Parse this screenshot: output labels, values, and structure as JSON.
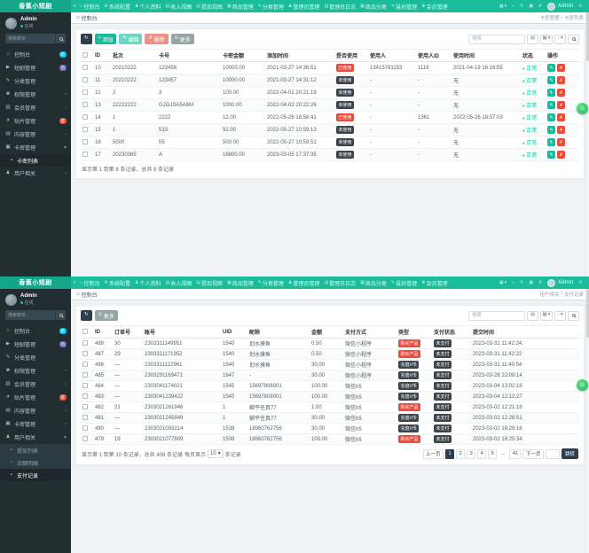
{
  "brand": "香蕉小短剧",
  "nav": {
    "items": [
      {
        "label": "控制台",
        "icon": "home-icon"
      },
      {
        "label": "系统配置",
        "icon": "gear-icon"
      },
      {
        "label": "个人资料",
        "icon": "person-icon"
      },
      {
        "label": "收入视图",
        "icon": "chart-icon"
      },
      {
        "label": "提现视图",
        "icon": "chart-icon"
      },
      {
        "label": "商品管理",
        "icon": "bag-icon"
      },
      {
        "label": "分类管理",
        "icon": "pencil-icon"
      },
      {
        "label": "管理员管理",
        "icon": "users-icon"
      },
      {
        "label": "管理员日志",
        "icon": "log-icon"
      },
      {
        "label": "商品分类",
        "icon": "bag-icon"
      },
      {
        "label": "装扮管理",
        "icon": "paint-icon"
      },
      {
        "label": "会员管理",
        "icon": "crown-icon"
      }
    ],
    "admin_name": "Admin"
  },
  "sidebar": {
    "user_name": "Admin",
    "user_status": "在线",
    "search_placeholder": "搜索菜单",
    "menu": [
      {
        "label": "控制台",
        "icon": "dashboard-icon",
        "badge": "新",
        "badge_color": "#00c0ef"
      },
      {
        "label": "短剧管理",
        "icon": "video-icon",
        "badge": "热",
        "badge_color": "#7266ba"
      },
      {
        "label": "分类管理",
        "icon": "category-icon"
      },
      {
        "label": "权限管理",
        "icon": "auth-icon",
        "chevron": true
      },
      {
        "label": "会员管理",
        "icon": "member-icon",
        "chevron": true
      },
      {
        "label": "贴片管理",
        "icon": "ad-icon",
        "badge": "荐",
        "badge_color": "#e74c3c"
      },
      {
        "label": "内容管理",
        "icon": "content-icon",
        "chevron": true
      },
      {
        "label": "卡密管理",
        "icon": "card-icon",
        "chevron": true,
        "key": "card",
        "children": [
          {
            "label": "卡密列表",
            "key": "cardlist"
          }
        ]
      },
      {
        "label": "用户相关",
        "icon": "user-icon",
        "chevron": true,
        "key": "user",
        "children": [
          {
            "label": "提现列表",
            "key": "withdraw"
          },
          {
            "label": "余额明细",
            "key": "balance"
          },
          {
            "label": "支付记录",
            "key": "payrecord"
          }
        ]
      }
    ]
  },
  "colors": {
    "accent": "#1abc9c",
    "danger": "#e74c3c",
    "dark_badge": "#3b434b",
    "sidebar": "#222d32",
    "page_active": "#2c3e50"
  },
  "screens": [
    {
      "tab": "控制台",
      "trail": [
        "卡密管理",
        "卡密列表"
      ],
      "sidebar_open": "card",
      "sidebar_active": "cardlist",
      "toolbar": {
        "buttons": [
          {
            "icon": "refresh-icon",
            "style": "dark",
            "name": "refresh-button"
          },
          {
            "icon": "plus-icon",
            "label": "添加",
            "style": "success",
            "name": "add-button"
          },
          {
            "icon": "edit-icon",
            "label": "编辑",
            "style": "success-light",
            "name": "edit-button"
          },
          {
            "icon": "trash-icon",
            "label": "删除",
            "style": "danger-light",
            "name": "delete-button"
          },
          {
            "icon": "more-icon",
            "label": "更多",
            "style": "gray",
            "name": "more-button"
          }
        ],
        "search_placeholder": "搜索"
      },
      "table": {
        "headers": [
          {
            "type": "chk"
          },
          {
            "label": "ID",
            "sort": "both"
          },
          {
            "label": "批次"
          },
          {
            "label": "卡号"
          },
          {
            "label": "卡密金额"
          },
          {
            "label": "添加时间",
            "sort": "both"
          },
          {
            "label": "是否使用"
          },
          {
            "label": "使用人"
          },
          {
            "label": "使用人ID"
          },
          {
            "label": "使用时间"
          },
          {
            "label": "状态"
          },
          {
            "label": "操作"
          }
        ],
        "rows": [
          [
            "10",
            "20210222",
            "123456",
            "10000.00",
            "2021-03-27 14:36:51",
            {
              "b": "已使用",
              "c": "danger"
            },
            "13415781153",
            "1119",
            "2021-04-19 16:16:55",
            {
              "s": "正常"
            },
            {
              "o": 1
            }
          ],
          [
            "11",
            "20210222",
            "123457",
            "10000.00",
            "2021-03-27 14:31:12",
            {
              "b": "未使用",
              "c": "dark"
            },
            "-",
            "-",
            "无",
            {
              "s": "正常"
            },
            {
              "o": 1
            }
          ],
          [
            "12",
            "2",
            "3",
            "100.00",
            "2022-04-02 20:21:19",
            {
              "b": "未使用",
              "c": "dark"
            },
            "-",
            "-",
            "无",
            {
              "s": "正常"
            },
            {
              "o": 1
            }
          ],
          [
            "13",
            "22222222",
            "GJGJSA5A6M",
            "1000.00",
            "2022-04-02 20:22:26",
            {
              "b": "未使用",
              "c": "dark"
            },
            "-",
            "-",
            "无",
            {
              "s": "正常"
            },
            {
              "o": 1
            }
          ],
          [
            "14",
            "1",
            "2222",
            "12.00",
            "2022-05-26 18:58:41",
            {
              "b": "已使用",
              "c": "danger"
            },
            "-",
            "1361",
            "2022-05-26 18:57:03",
            {
              "s": "正常"
            },
            {
              "o": 1
            }
          ],
          [
            "15",
            "1",
            "533",
            "92.00",
            "2022-05-27 10:59:13",
            {
              "b": "未使用",
              "c": "dark"
            },
            "-",
            "-",
            "无",
            {
              "s": "正常"
            },
            {
              "o": 1
            }
          ],
          [
            "16",
            "5000",
            "55",
            "500.00",
            "2022-05-27 10:59:51",
            {
              "b": "未使用",
              "c": "dark"
            },
            "-",
            "-",
            "无",
            {
              "s": "正常"
            },
            {
              "o": 1
            }
          ],
          [
            "17",
            "20230365",
            "A",
            "16800.00",
            "2023-03-05 17:37:35",
            {
              "b": "未使用",
              "c": "dark"
            },
            "-",
            "-",
            "无",
            {
              "s": "正常"
            },
            {
              "o": 1
            }
          ]
        ]
      },
      "footer_text": "显示第 1 到第 8 条记录，总共 8 条记录"
    },
    {
      "tab": "控制台",
      "trail": [
        "用户相关",
        "支付记录"
      ],
      "sidebar_open": "user",
      "sidebar_active": "payrecord",
      "toolbar": {
        "buttons": [
          {
            "icon": "refresh-icon",
            "style": "dark",
            "name": "refresh-button"
          },
          {
            "icon": "more-icon",
            "label": "更多",
            "style": "gray",
            "name": "more-button"
          }
        ],
        "search_placeholder": "搜索"
      },
      "table": {
        "headers": [
          {
            "type": "chk"
          },
          {
            "label": "ID",
            "sort": "down"
          },
          {
            "label": "订单号"
          },
          {
            "label": "账号"
          },
          {
            "label": "UID"
          },
          {
            "label": "昵称"
          },
          {
            "label": "金额"
          },
          {
            "label": "支付方式"
          },
          {
            "label": "类型"
          },
          {
            "label": "支付状态"
          },
          {
            "label": "提交时间",
            "sort": "both"
          }
        ],
        "rows": [
          [
            "488",
            "30",
            "2303311149951",
            "1540",
            "划水摸鱼",
            "0.50",
            "微信小程序",
            {
              "b": "购买产品",
              "c": "danger"
            },
            {
              "b": "未支付",
              "c": "dark"
            },
            "2023-03-31 11:42:24"
          ],
          [
            "487",
            "29",
            "2303311171952",
            "1540",
            "划水摸鱼",
            "0.50",
            "微信小程序",
            {
              "b": "购买产品",
              "c": "danger"
            },
            {
              "b": "未支付",
              "c": "dark"
            },
            "2023-03-31 11:42:22"
          ],
          [
            "486",
            "—",
            "2303311122961",
            "1540",
            "划水摸鱼",
            "30.00",
            "微信小程序",
            {
              "b": "充值V币",
              "c": "dark"
            },
            {
              "b": "未支付",
              "c": "dark"
            },
            "2023-03-31 11:40:54"
          ],
          [
            "485",
            "—",
            "2303291169471",
            "1647",
            "-",
            "30.00",
            "微信小程序",
            {
              "b": "充值V币",
              "c": "dark"
            },
            {
              "b": "未支付",
              "c": "dark"
            },
            "2023-03-28 22:09:14"
          ],
          [
            "484",
            "—",
            "2303041174021",
            "1545",
            "15697808001",
            "100.00",
            "微信h5",
            {
              "b": "充值V币",
              "c": "dark"
            },
            {
              "b": "未支付",
              "c": "dark"
            },
            "2023-03-04 13:02:16"
          ],
          [
            "483",
            "—",
            "2303041239422",
            "1545",
            "15697808001",
            "100.00",
            "微信h5",
            {
              "b": "充值V币",
              "c": "dark"
            },
            {
              "b": "未支付",
              "c": "dark"
            },
            "2023-03-04 12:12:27"
          ],
          [
            "482",
            "21",
            "2303021261946",
            "1",
            "躺平任真77",
            "1.00",
            "微信h5",
            {
              "b": "购买产品",
              "c": "danger"
            },
            {
              "b": "未支付",
              "c": "dark"
            },
            "2023-03-02 12:21:16"
          ],
          [
            "481",
            "—",
            "2303021245949",
            "1",
            "躺平任真77",
            "30.00",
            "微信h5",
            {
              "b": "充值V币",
              "c": "dark"
            },
            {
              "b": "未支付",
              "c": "dark"
            },
            "2023-03-02 12:26:51"
          ],
          [
            "480",
            "—",
            "2303021093214",
            "1538",
            "18960762756",
            "30.00",
            "微信h5",
            {
              "b": "充值V币",
              "c": "dark"
            },
            {
              "b": "未支付",
              "c": "dark"
            },
            "2023-03-02 16:29:16"
          ],
          [
            "479",
            "19",
            "2303021077809",
            "1538",
            "18960762756",
            "100.00",
            "微信h5",
            {
              "b": "购买产品",
              "c": "danger"
            },
            {
              "b": "未支付",
              "c": "dark"
            },
            "2023-03-02 16:25:34"
          ]
        ]
      },
      "footer_text": "显示第 1 到第 10 条记录，总共 408 条记录",
      "per_page_label": "每页显示",
      "per_page": "10",
      "per_page_suffix": "条记录",
      "pagination": {
        "prev": "上一页",
        "pages": [
          "1",
          "2",
          "3",
          "4",
          "5",
          "...",
          "41"
        ],
        "active": "1",
        "next": "下一页",
        "jump_label": "跳转"
      }
    }
  ]
}
